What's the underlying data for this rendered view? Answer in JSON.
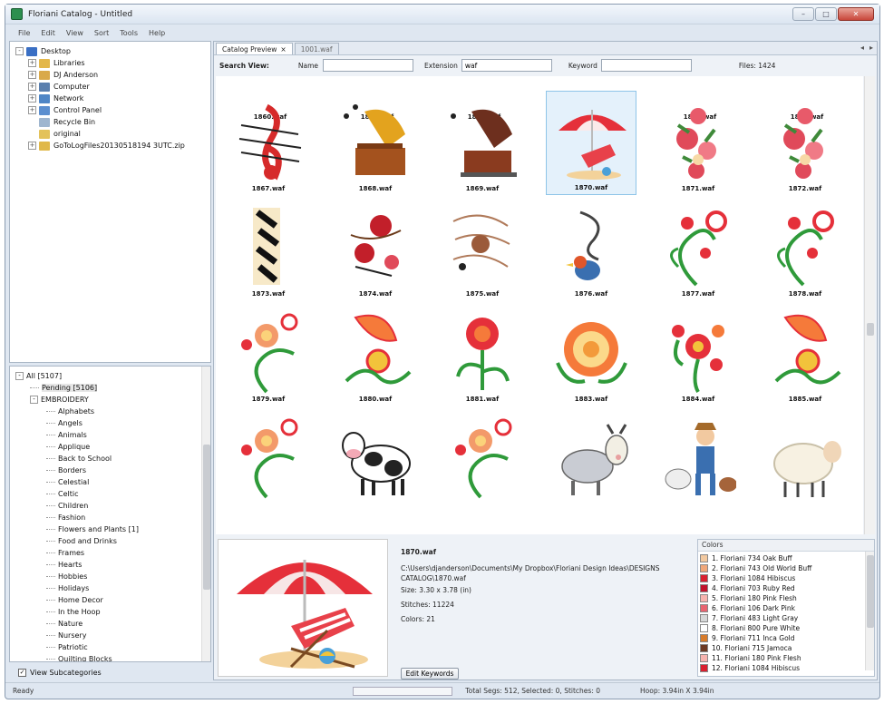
{
  "window": {
    "title": "Floriani Catalog - Untitled"
  },
  "menu": [
    "File",
    "Edit",
    "View",
    "Sort",
    "Tools",
    "Help"
  ],
  "tree": [
    {
      "label": "Desktop",
      "icon": "desktop-icon",
      "color": "#3a6fc4",
      "level": 0,
      "expander": "-"
    },
    {
      "label": "Libraries",
      "icon": "libraries-icon",
      "color": "#e3b74a",
      "level": 1,
      "expander": "+"
    },
    {
      "label": "DJ Anderson",
      "icon": "user-folder-icon",
      "color": "#d9a94a",
      "level": 1,
      "expander": "+"
    },
    {
      "label": "Computer",
      "icon": "computer-icon",
      "color": "#5a7fae",
      "level": 1,
      "expander": "+"
    },
    {
      "label": "Network",
      "icon": "network-icon",
      "color": "#4f86c6",
      "level": 1,
      "expander": "+"
    },
    {
      "label": "Control Panel",
      "icon": "control-panel-icon",
      "color": "#5c8fcf",
      "level": 1,
      "expander": "+"
    },
    {
      "label": "Recycle Bin",
      "icon": "recycle-bin-icon",
      "color": "#9fb6cf",
      "level": 1,
      "expander": ""
    },
    {
      "label": "original",
      "icon": "folder-icon",
      "color": "#e3c25a",
      "level": 1,
      "expander": ""
    },
    {
      "label": "GoToLogFiles20130518194 3UTC.zip",
      "icon": "zip-icon",
      "color": "#e0b84a",
      "level": 1,
      "expander": "+"
    }
  ],
  "categories": {
    "all": "All [5107]",
    "pending": "Pending [5106]",
    "embroidery": "EMBROIDERY",
    "items": [
      "Alphabets",
      "Angels",
      "Animals",
      "Applique",
      "Back to School",
      "Borders",
      "Celestial",
      "Celtic",
      "Children",
      "Fashion",
      "Flowers and Plants [1]",
      "Food and Drinks",
      "Frames",
      "Hearts",
      "Hobbies",
      "Holidays",
      "Home Decor",
      "In the Hoop",
      "Nature",
      "Nursery",
      "Patriotic",
      "Quilting Blocks"
    ]
  },
  "view_subcategories": "View Subcategories",
  "tabs": [
    {
      "label": "Catalog Preview",
      "close": "×"
    },
    {
      "label": "1001.waf"
    }
  ],
  "tabnav": [
    "◂",
    "▸"
  ],
  "search": {
    "label": "Search View:",
    "name_label": "Name",
    "name_value": "",
    "ext_label": "Extension",
    "ext_value": "waf",
    "keyword_label": "Keyword",
    "keyword_value": "",
    "files": "Files: 1424"
  },
  "top_row_names": [
    "1860.waf",
    "1861.waf",
    "1862.waf",
    "1863.waf",
    "1864.waf",
    "1866.waf"
  ],
  "thumbnails": [
    {
      "name": "1867.waf",
      "motif": "music-note"
    },
    {
      "name": "1868.waf",
      "motif": "gramophone"
    },
    {
      "name": "1869.waf",
      "motif": "gramophone-dark"
    },
    {
      "name": "1870.waf",
      "motif": "umbrella",
      "selected": true
    },
    {
      "name": "1871.waf",
      "motif": "roses"
    },
    {
      "name": "1872.waf",
      "motif": "roses"
    },
    {
      "name": "1873.waf",
      "motif": "music-notes-vertical"
    },
    {
      "name": "1874.waf",
      "motif": "roses-notes"
    },
    {
      "name": "1875.waf",
      "motif": "music-bird"
    },
    {
      "name": "1876.waf",
      "motif": "bird"
    },
    {
      "name": "1877.waf",
      "motif": "swirl-flowers"
    },
    {
      "name": "1878.waf",
      "motif": "swirl-flowers"
    },
    {
      "name": "1879.waf",
      "motif": "flower-swirl"
    },
    {
      "name": "1880.waf",
      "motif": "butterfly-flower"
    },
    {
      "name": "1881.waf",
      "motif": "red-flower"
    },
    {
      "name": "1883.waf",
      "motif": "big-flower"
    },
    {
      "name": "1884.waf",
      "motif": "flower-cluster"
    },
    {
      "name": "1885.waf",
      "motif": "butterfly-flower"
    },
    {
      "name": "",
      "motif": "flower-swirl"
    },
    {
      "name": "",
      "motif": "cow"
    },
    {
      "name": "",
      "motif": "flower-swirl"
    },
    {
      "name": "",
      "motif": "goat"
    },
    {
      "name": "",
      "motif": "farmer"
    },
    {
      "name": "",
      "motif": "sheep"
    }
  ],
  "details": {
    "filename": "1870.waf",
    "path": "C:\\Users\\djanderson\\Documents\\My Dropbox\\Floriani Design Ideas\\DESIGNS CATALOG\\1870.waf",
    "size": "Size: 3.30 x 3.78 (in)",
    "stitches": "Stitches: 11224",
    "colors": "Colors: 21",
    "edit_keywords": "Edit Keywords"
  },
  "colors_panel": {
    "header": "Colors",
    "items": [
      {
        "label": "1. Floriani 734 Oak Buff",
        "hex": "#f2c9a0"
      },
      {
        "label": "2. Floriani 743 Old World Buff",
        "hex": "#f0a77a"
      },
      {
        "label": "3. Floriani 1084 Hibiscus",
        "hex": "#d9202f"
      },
      {
        "label": "4. Floriani 703 Ruby Red",
        "hex": "#c1122b"
      },
      {
        "label": "5. Floriani 180 Pink Flesh",
        "hex": "#f6b3ae"
      },
      {
        "label": "6. Floriani 106 Dark Pink",
        "hex": "#e8636f"
      },
      {
        "label": "7. Floriani 483 Light Gray",
        "hex": "#d6d8d8"
      },
      {
        "label": "8. Floriani 800 Pure White",
        "hex": "#ffffff"
      },
      {
        "label": "9. Floriani 711 Inca Gold",
        "hex": "#d77b2a"
      },
      {
        "label": "10. Floriani 715 Jamoca",
        "hex": "#6d3a23"
      },
      {
        "label": "11. Floriani 180 Pink Flesh",
        "hex": "#f6b3ae"
      },
      {
        "label": "12. Floriani 1084 Hibiscus",
        "hex": "#d9202f"
      }
    ]
  },
  "status": {
    "ready": "Ready",
    "segs": "Total Segs: 512, Selected: 0, Stitches: 0",
    "hoop": "Hoop: 3.94in X 3.94in"
  }
}
